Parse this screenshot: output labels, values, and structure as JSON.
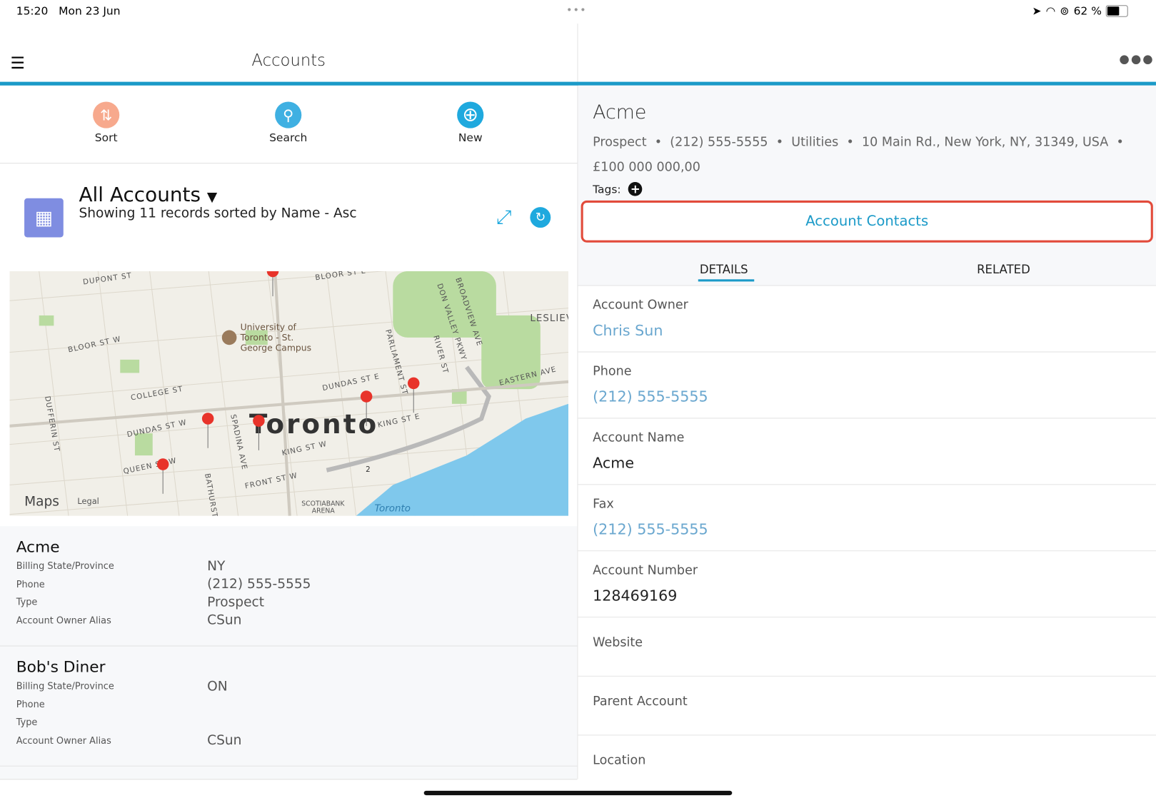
{
  "status_bar": {
    "time": "15:20",
    "date": "Mon 23 Jun",
    "battery": "62 %",
    "battery_level": 62
  },
  "left_header": {
    "title": "Accounts"
  },
  "toolbar": {
    "sort": "Sort",
    "search": "Search",
    "new": "New",
    "sort_color": "#f7a98d",
    "search_color": "#3fb0e2",
    "new_color": "#1fa9de"
  },
  "list_view": {
    "title": "All Accounts",
    "subtitle": "Showing 11 records sorted by Name - Asc",
    "icon_color": "#7f8de1"
  },
  "map": {
    "city_label": "Toronto",
    "water_label": "Toronto",
    "campus_label": [
      "University of",
      "Toronto - St.",
      "George Campus"
    ],
    "arena_label": [
      "SCOTIABANK",
      "ARENA"
    ],
    "attribution": "Maps",
    "legal": "Legal",
    "streets": [
      "DUPONT ST",
      "BLOOR ST W",
      "BLOOR ST E",
      "COLLEGE ST",
      "DUNDAS ST W",
      "DUNDAS ST E",
      "KING ST W",
      "KING ST E",
      "QUEEN ST W",
      "FRONT ST W",
      "SPADINA AVE",
      "BATHURST",
      "PARLIAMENT ST",
      "RIVER ST",
      "DON VALLEY PKWY",
      "BROADVIEW AVE",
      "EASTERN AVE",
      "DUFFERIN ST",
      "LESLIEV"
    ],
    "highway_shield": "2"
  },
  "accounts": [
    {
      "name": "Acme",
      "fields": [
        {
          "label": "Billing State/Province",
          "value": "NY"
        },
        {
          "label": "Phone",
          "value": "(212) 555-5555"
        },
        {
          "label": "Type",
          "value": "Prospect"
        },
        {
          "label": "Account Owner Alias",
          "value": "CSun"
        }
      ]
    },
    {
      "name": "Bob's Diner",
      "fields": [
        {
          "label": "Billing State/Province",
          "value": "ON"
        },
        {
          "label": "Phone",
          "value": ""
        },
        {
          "label": "Type",
          "value": ""
        },
        {
          "label": "Account Owner Alias",
          "value": "CSun"
        }
      ]
    }
  ],
  "detail": {
    "title": "Acme",
    "summary": "Prospect  •  (212) 555-5555  •  Utilities  •  10 Main Rd., New York, NY, 31349, USA  •",
    "amount": "£100 000 000,00",
    "tags_label": "Tags:",
    "contacts_button": "Account Contacts",
    "tabs": [
      {
        "label": "DETAILS",
        "active": true
      },
      {
        "label": "RELATED",
        "active": false
      }
    ],
    "fields": [
      {
        "label": "Account Owner",
        "value": "Chris Sun",
        "link": true
      },
      {
        "label": "Phone",
        "value": "(212) 555-5555",
        "link": true
      },
      {
        "label": "Account Name",
        "value": "Acme",
        "link": false
      },
      {
        "label": "Fax",
        "value": "(212) 555-5555",
        "link": true
      },
      {
        "label": "Account Number",
        "value": "128469169",
        "link": false
      },
      {
        "label": "Website",
        "value": "",
        "link": false
      },
      {
        "label": "Parent Account",
        "value": "",
        "link": false
      },
      {
        "label": "Location",
        "value": "",
        "link": false
      }
    ]
  },
  "colors": {
    "accent": "#1b9ac8",
    "highlight_border": "#e24b3b",
    "link": "#6aa7cf",
    "pin": "#e8332a"
  }
}
